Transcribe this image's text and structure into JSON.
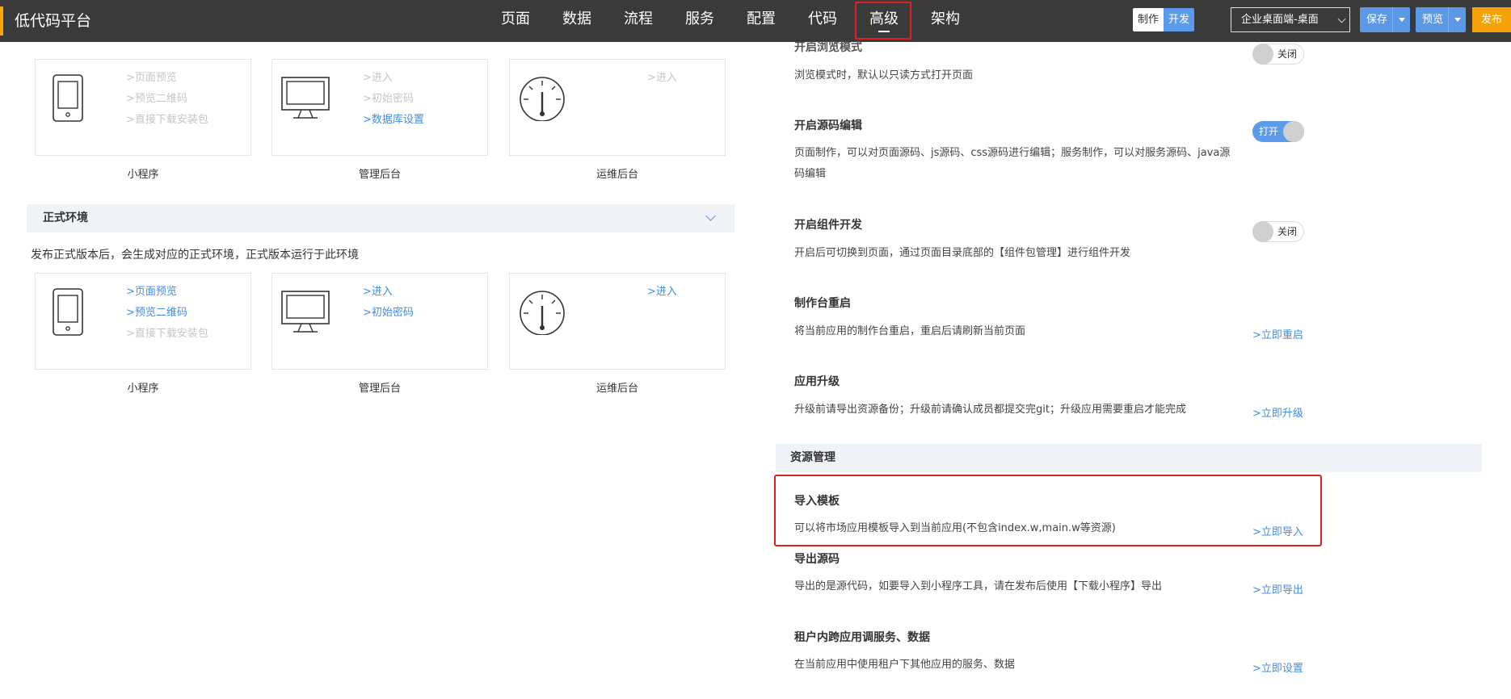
{
  "app": {
    "logo": "低代码平台"
  },
  "nav": {
    "items": [
      {
        "label": "页面"
      },
      {
        "label": "数据"
      },
      {
        "label": "流程"
      },
      {
        "label": "服务"
      },
      {
        "label": "配置"
      },
      {
        "label": "代码"
      },
      {
        "label": "高级"
      },
      {
        "label": "架构"
      }
    ],
    "active": "高级"
  },
  "toolbar": {
    "mode_make": "制作",
    "mode_dev": "开发",
    "app_select": "企业桌面端-桌面",
    "save_label": "保存",
    "preview_label": "预览",
    "publish_label": "发布"
  },
  "test_env": {
    "cards": [
      {
        "caption": "小程序",
        "icon": "mobile-icon",
        "links": [
          {
            "text": ">页面预览",
            "enabled": false
          },
          {
            "text": ">预览二维码",
            "enabled": false
          },
          {
            "text": ">直接下载安装包",
            "enabled": false
          }
        ]
      },
      {
        "caption": "管理后台",
        "icon": "monitor-icon",
        "links": [
          {
            "text": ">进入",
            "enabled": false
          },
          {
            "text": ">初始密码",
            "enabled": false
          },
          {
            "text": ">数据库设置",
            "enabled": true
          }
        ]
      },
      {
        "caption": "运维后台",
        "icon": "gauge-icon",
        "links": [
          {
            "text": ">进入",
            "enabled": false
          }
        ]
      }
    ]
  },
  "prod_env": {
    "title": "正式环境",
    "description": "发布正式版本后，会生成对应的正式环境，正式版本运行于此环境",
    "cards": [
      {
        "caption": "小程序",
        "icon": "mobile-icon",
        "links": [
          {
            "text": ">页面预览",
            "enabled": true
          },
          {
            "text": ">预览二维码",
            "enabled": true
          },
          {
            "text": ">直接下载安装包",
            "enabled": false
          }
        ]
      },
      {
        "caption": "管理后台",
        "icon": "monitor-icon",
        "links": [
          {
            "text": ">进入",
            "enabled": true
          },
          {
            "text": ">初始密码",
            "enabled": true
          }
        ]
      },
      {
        "caption": "运维后台",
        "icon": "gauge-icon",
        "links": [
          {
            "text": ">进入",
            "enabled": true
          }
        ]
      }
    ]
  },
  "settings": {
    "browse_mode": {
      "title": "开启浏览模式",
      "desc": "浏览模式时，默认以只读方式打开页面",
      "toggle": "关闭"
    },
    "source_edit": {
      "title": "开启源码编辑",
      "desc": "页面制作，可以对页面源码、js源码、css源码进行编辑；服务制作，可以对服务源码、java源码编辑",
      "toggle": "打开"
    },
    "component_dev": {
      "title": "开启组件开发",
      "desc": "开启后可切换到页面，通过页面目录底部的【组件包管理】进行组件开发",
      "toggle": "关闭"
    },
    "restart": {
      "title": "制作台重启",
      "desc": "将当前应用的制作台重启，重启后请刷新当前页面",
      "link": ">立即重启"
    },
    "upgrade": {
      "title": "应用升级",
      "desc": "升级前请导出资源备份；升级前请确认成员都提交完git；升级应用需要重启才能完成",
      "link": ">立即升级"
    }
  },
  "resources": {
    "title": "资源管理",
    "import": {
      "title": "导入模板",
      "desc": "可以将市场应用模板导入到当前应用(不包含index.w,main.w等资源)",
      "link": ">立即导入"
    },
    "export": {
      "title": "导出源码",
      "desc": "导出的是源代码，如要导入到小程序工具，请在发布后使用【下载小程序】导出",
      "link": ">立即导出"
    },
    "cross_app": {
      "title": "租户内跨应用调服务、数据",
      "desc": "在当前应用中使用租户下其他应用的服务、数据",
      "link": ">立即设置"
    }
  }
}
